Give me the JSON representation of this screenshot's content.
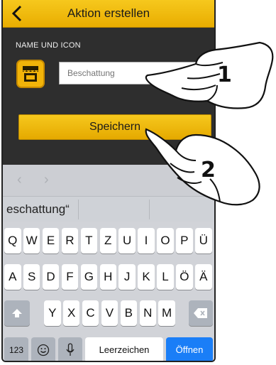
{
  "header": {
    "title": "Aktion erstellen"
  },
  "section": {
    "label": "NAME UND ICON"
  },
  "name_field": {
    "placeholder": "Beschattung"
  },
  "save_button": {
    "label": "Speichern"
  },
  "prediction": {
    "text": "eschattung“"
  },
  "keyboard": {
    "row1": [
      "Q",
      "W",
      "E",
      "R",
      "T",
      "Z",
      "U",
      "I",
      "O",
      "P",
      "Ü"
    ],
    "row2": [
      "A",
      "S",
      "D",
      "F",
      "G",
      "H",
      "J",
      "K",
      "L",
      "Ö",
      "Ä"
    ],
    "row3": [
      "Y",
      "X",
      "C",
      "V",
      "B",
      "N",
      "M"
    ],
    "numbers_key": "123",
    "space_key": "Leerzeichen",
    "return_key": "Öffnen"
  },
  "annotations": {
    "step1": "1",
    "step2": "2"
  },
  "colors": {
    "accent": "#f2b409",
    "dark_panel": "#2e2e2e",
    "return_key": "#1a7ef7"
  }
}
